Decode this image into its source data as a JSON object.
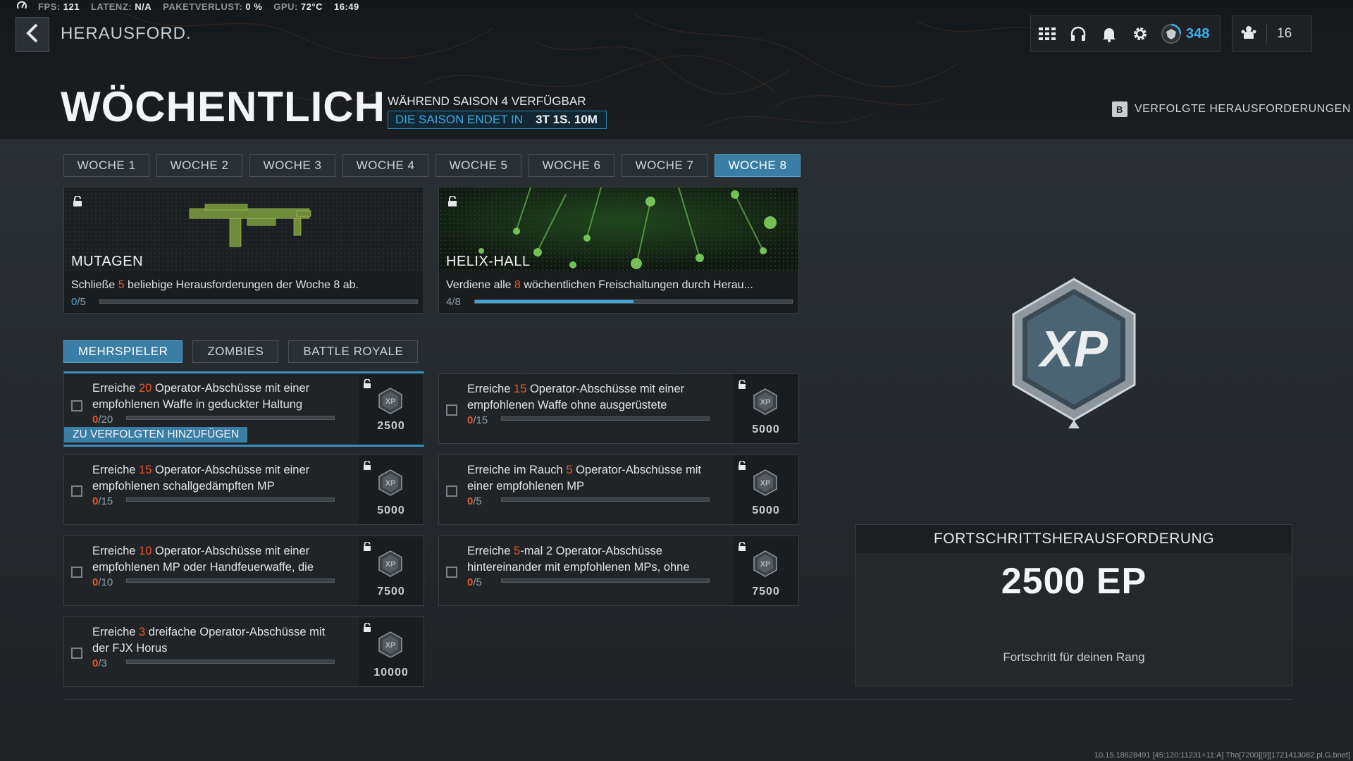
{
  "status_bar": {
    "fps_label": "FPS:",
    "fps": "121",
    "latency_label": "LATENZ:",
    "latency": "N/A",
    "packetloss_label": "PAKETVERLUST:",
    "packetloss": "0 %",
    "gpu_label": "GPU:",
    "gpu": "72°C",
    "clock": "16:49"
  },
  "header": {
    "back_title": "HERAUSFORD.",
    "rank_value": "348",
    "party_count": "16",
    "page_title": "WÖCHENTLICH",
    "season_note": "WÄHREND SAISON 4 VERFÜGBAR",
    "season_end_label": "DIE SAISON ENDET IN",
    "season_end_value": "3T 1S. 10M",
    "tracked_key": "B",
    "tracked_label": "VERFOLGTE HERAUSFORDERUNGEN"
  },
  "weeks": [
    {
      "label": "WOCHE 1",
      "active": false
    },
    {
      "label": "WOCHE 2",
      "active": false
    },
    {
      "label": "WOCHE 3",
      "active": false
    },
    {
      "label": "WOCHE 4",
      "active": false
    },
    {
      "label": "WOCHE 5",
      "active": false
    },
    {
      "label": "WOCHE 6",
      "active": false
    },
    {
      "label": "WOCHE 7",
      "active": false
    },
    {
      "label": "WOCHE 8",
      "active": true
    }
  ],
  "rewards": [
    {
      "name": "MUTAGEN",
      "desc_pre": "Schließe ",
      "desc_num": "5",
      "desc_post": " beliebige Herausforderungen der Woche 8 ab.",
      "progress_current": "0",
      "progress_total": "/5",
      "progress_fraction": 0
    },
    {
      "name": "HELIX-HALL",
      "desc_pre": "Verdiene alle ",
      "desc_num": "8",
      "desc_post": " wöchentlichen Freischaltungen durch Herau...",
      "progress_current": "4",
      "progress_total": "/8",
      "progress_fraction": 0.5
    }
  ],
  "modes": [
    {
      "label": "MEHRSPIELER",
      "active": true
    },
    {
      "label": "ZOMBIES",
      "active": false
    },
    {
      "label": "BATTLE ROYALE",
      "active": false
    }
  ],
  "challenges": [
    {
      "pre": "Erreiche ",
      "num": "20",
      "post": " Operator-Abschüsse mit einer empfohlenen Waffe in geduckter Haltung",
      "count": "0",
      "total": "/20",
      "xp": "2500",
      "selected": true,
      "track_label": "ZU VERFOLGTEN HINZUFÜGEN"
    },
    {
      "pre": "Erreiche ",
      "num": "15",
      "post": " Operator-Abschüsse mit einer empfohlenen Waffe ohne ausgerüstete",
      "count": "0",
      "total": "/15",
      "xp": "5000"
    },
    {
      "pre": "Erreiche ",
      "num": "15",
      "post": " Operator-Abschüsse mit einer empfohlenen schallgedämpften MP",
      "count": "0",
      "total": "/15",
      "xp": "5000"
    },
    {
      "pre": "Erreiche im Rauch ",
      "num": "5",
      "post": " Operator-Abschüsse mit einer empfohlenen MP",
      "count": "0",
      "total": "/5",
      "xp": "5000"
    },
    {
      "pre": "Erreiche ",
      "num": "10",
      "post": " Operator-Abschüsse mit einer empfohlenen MP oder Handfeuerwaffe, die",
      "count": "0",
      "total": "/10",
      "xp": "7500"
    },
    {
      "pre": "Erreiche ",
      "num": "5",
      "post": "-mal 2 Operator-Abschüsse hintereinander mit empfohlenen MPs, ohne",
      "count": "0",
      "total": "/5",
      "xp": "7500"
    },
    {
      "pre": "Erreiche ",
      "num": "3",
      "post": " dreifache Operator-Abschüsse mit der FJX Horus",
      "count": "0",
      "total": "/3",
      "xp": "10000"
    }
  ],
  "progress_panel": {
    "title": "FORTSCHRITTSHERAUSFORDERUNG",
    "amount": "2500 EP",
    "subtitle": "Fortschritt für deinen Rang"
  },
  "build_info": "10.15.18628491 [45:120:11231+11:A] Tho[7200][9][1721413082.pl.G.bnet]",
  "colors": {
    "accent": "#3b7ea5",
    "highlight": "#e8552d",
    "progress": "#3ea7d8"
  }
}
